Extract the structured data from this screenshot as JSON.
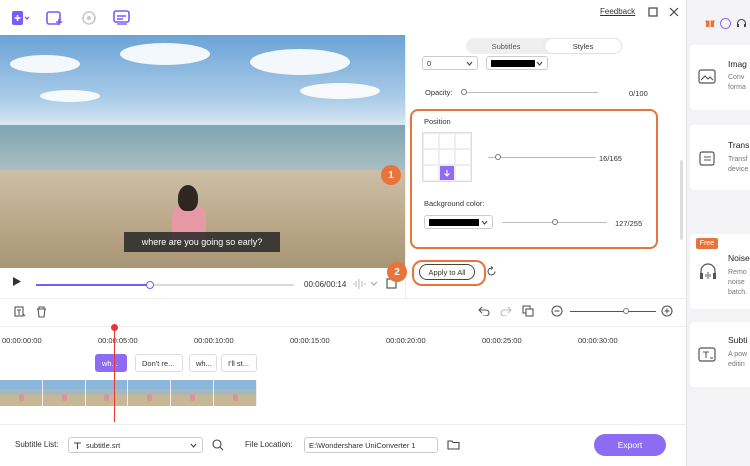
{
  "header": {
    "feedback": "Feedback"
  },
  "video": {
    "subtitle_text": "where are you going so early?"
  },
  "player": {
    "timecode": "00:06/00:14",
    "progress": 0.44
  },
  "panel": {
    "tabs": [
      "Subtitles",
      "Styles"
    ],
    "active_tab": "Styles",
    "font_size_value": "0",
    "opacity_label": "Opacity:",
    "opacity_value": "0/100",
    "position_label": "Position",
    "position_value": "16/165",
    "bg_color_label": "Background color:",
    "bg_opacity_value": "127/255",
    "apply_all": "Apply to All",
    "step1": "1",
    "step2": "2"
  },
  "timeline": {
    "ticks": [
      "00:00:00:00",
      "00:00:05:00",
      "00:00:10:00",
      "00:00:15:00",
      "00:00:20:00",
      "00:00:25:00",
      "00:00:30:00"
    ],
    "clips": [
      "wh...",
      "Don't re...",
      "wh...",
      "I'll st..."
    ]
  },
  "bottom": {
    "subtitle_list_label": "Subtitle List:",
    "subtitle_file": "subtitle.srt",
    "file_location_label": "File Location:",
    "file_location_value": "E:\\Wondershare UniConverter 1",
    "export": "Export"
  },
  "sidebar": {
    "cards": [
      {
        "title": "Imag",
        "desc": [
          "Conv",
          "forma"
        ]
      },
      {
        "title": "Trans",
        "desc": [
          "Transf",
          "device"
        ]
      },
      {
        "title": "Noise",
        "desc": [
          "Remo",
          "noise",
          "batch."
        ]
      },
      {
        "title": "Subti",
        "desc": [
          "A pow",
          "editin"
        ]
      }
    ],
    "free_badge": "Free"
  },
  "colors": {
    "accent": "#8c6cf2",
    "highlight": "#e8743b",
    "playhead": "#ee3333"
  }
}
